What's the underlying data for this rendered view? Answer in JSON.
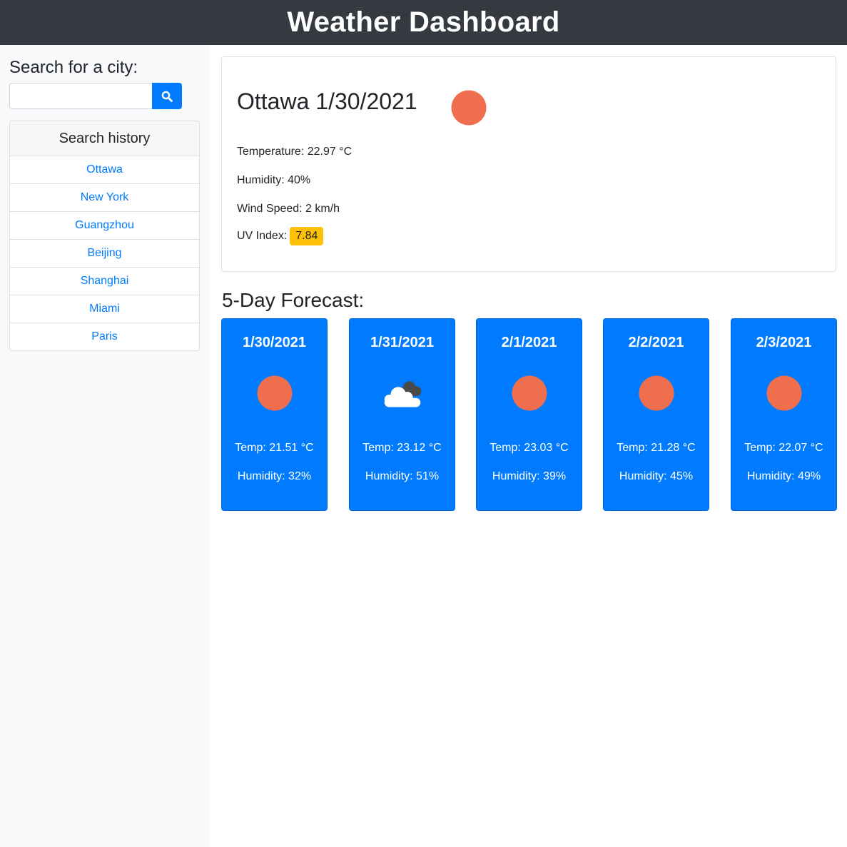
{
  "header": {
    "title": "Weather Dashboard"
  },
  "sidebar": {
    "search_label": "Search for a city:",
    "search_value": "",
    "search_placeholder": "",
    "history_title": "Search history",
    "history": [
      "Ottawa",
      "New York",
      "Guangzhou",
      "Beijing",
      "Shanghai",
      "Miami",
      "Paris"
    ]
  },
  "current": {
    "title": "Ottawa 1/30/2021",
    "icon": "sun-icon",
    "temperature": "Temperature: 22.97 °C",
    "humidity": "Humidity: 40%",
    "wind": "Wind Speed: 2 km/h",
    "uv_label": "UV Index:",
    "uv_value": "7.84",
    "uv_color": "#ffc107"
  },
  "forecast": {
    "title": "5-Day Forecast:",
    "days": [
      {
        "date": "1/30/2021",
        "icon": "sun-icon",
        "temp": "Temp: 21.51 °C",
        "humidity": "Humidity: 32%"
      },
      {
        "date": "1/31/2021",
        "icon": "cloud-icon",
        "temp": "Temp: 23.12 °C",
        "humidity": "Humidity: 51%"
      },
      {
        "date": "2/1/2021",
        "icon": "sun-icon",
        "temp": "Temp: 23.03 °C",
        "humidity": "Humidity: 39%"
      },
      {
        "date": "2/2/2021",
        "icon": "sun-icon",
        "temp": "Temp: 21.28 °C",
        "humidity": "Humidity: 45%"
      },
      {
        "date": "2/3/2021",
        "icon": "sun-icon",
        "temp": "Temp: 22.07 °C",
        "humidity": "Humidity: 49%"
      }
    ]
  },
  "colors": {
    "header_bg": "#343a40",
    "primary": "#007bff",
    "sun": "#ee6e4e",
    "uv_badge": "#ffc107"
  }
}
